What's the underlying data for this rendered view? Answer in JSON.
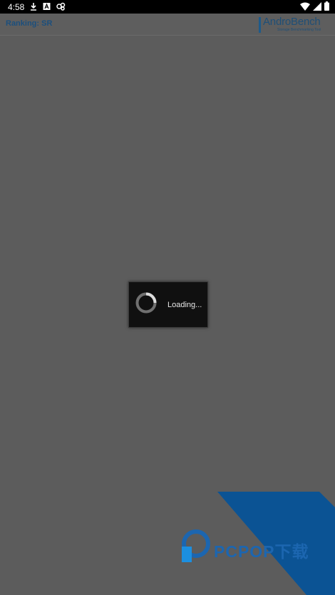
{
  "status_bar": {
    "time": "4:58",
    "left_icons": [
      "download-icon",
      "a-icon",
      "link-icon"
    ],
    "right_icons": [
      "wifi-icon",
      "signal-icon",
      "battery-icon"
    ]
  },
  "header": {
    "title": "Ranking: SR",
    "logo": {
      "name": "AndroBench",
      "tagline": "Storage Benchmarking Tool"
    }
  },
  "dialog": {
    "loading_text": "Loading..."
  },
  "watermark": {
    "text": "PCPOP下载"
  },
  "colors": {
    "background": "#5c5c5c",
    "title": "#1c4f7d",
    "watermark_blue": "#0b5394"
  }
}
